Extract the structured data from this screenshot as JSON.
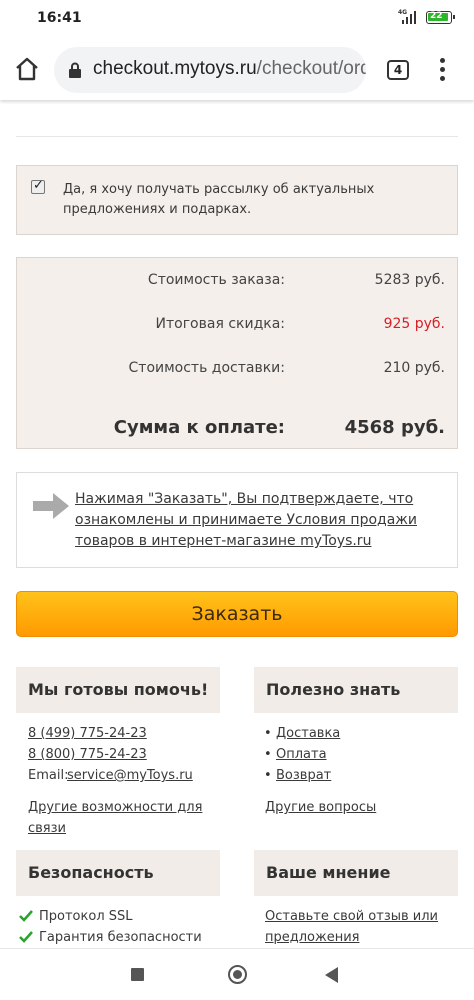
{
  "status_bar": {
    "time": "16:41",
    "network": "4G",
    "battery": "22"
  },
  "browser": {
    "url_main": "checkout.mytoys.ru",
    "url_path": "/checkout/ord",
    "tab_count": "4"
  },
  "newsletter": {
    "checked": true,
    "text": "Да, я хочу получать рассылку об актуальных предложениях и подарках."
  },
  "summary": {
    "order_cost_label": "Стоимость заказа:",
    "order_cost_value": "5283 руб.",
    "discount_label": "Итоговая скидка:",
    "discount_value": "925 руб.",
    "delivery_label": "Стоимость доставки:",
    "delivery_value": "210 руб.",
    "total_label": "Сумма к оплате:",
    "total_value": "4568 руб."
  },
  "confirm_text": "Нажимая \"Заказать\", Вы подтверждаете, что ознакомлены и принимаете Условия продажи товаров в интернет-магазине myToys.ru",
  "order_button": "Заказать",
  "help": {
    "title": "Мы готовы помочь!",
    "phone1": "8 (499) 775-24-23",
    "phone2": "8 (800) 775-24-23",
    "email_label": "Email:",
    "email": "service@myToys.ru",
    "other_line1": "Другие возможности для",
    "other_line2": "связи"
  },
  "useful": {
    "title": "Полезно знать",
    "items": [
      "Доставка",
      "Оплата",
      "Возврат"
    ],
    "other": "Другие вопросы"
  },
  "security": {
    "title": "Безопасность",
    "items": [
      "Протокол SSL",
      "Гарантия безопасности"
    ]
  },
  "opinion": {
    "title": "Ваше мнение",
    "link_line1": "Оставьте свой отзыв или",
    "link_line2": "предложения"
  },
  "colors": {
    "accent": "#ff9a00",
    "discount": "#d61f26",
    "panel": "#f4efeb"
  }
}
